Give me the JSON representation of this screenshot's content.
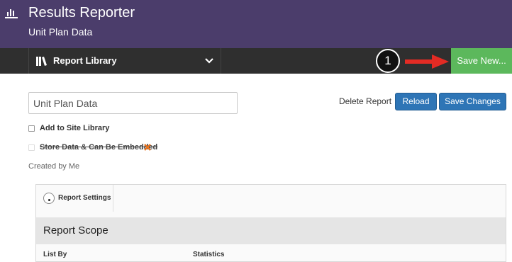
{
  "app": {
    "title": "Results Reporter",
    "subtitle": "Unit Plan Data",
    "icon": "bar-chart-icon"
  },
  "toolbar": {
    "library_label": "Report Library",
    "library_icon": "library-books-icon",
    "dropdown_icon": "chevron-down-icon",
    "save_new_label": "Save New...",
    "save_new_color": "#5cb85c"
  },
  "callout": {
    "number": "1"
  },
  "report": {
    "name_value": "Unit Plan Data",
    "delete_label": "Delete Report",
    "reload_label": "Reload",
    "save_changes_label": "Save Changes",
    "button_color": "#2e75b6",
    "add_to_site_label": "Add to Site Library",
    "add_to_site_checked": false,
    "store_data_label": "Store Data & Can Be Embedded",
    "store_data_checked": false,
    "created_by": "Created by Me"
  },
  "panel": {
    "settings_tab_label": "Report Settings",
    "scope_title": "Report Scope",
    "list_by_label": "List By",
    "statistics_label": "Statistics"
  },
  "colors": {
    "header": "#4b3d6b",
    "toolbar": "#2f2f2f",
    "arrow": "#e32b24"
  }
}
